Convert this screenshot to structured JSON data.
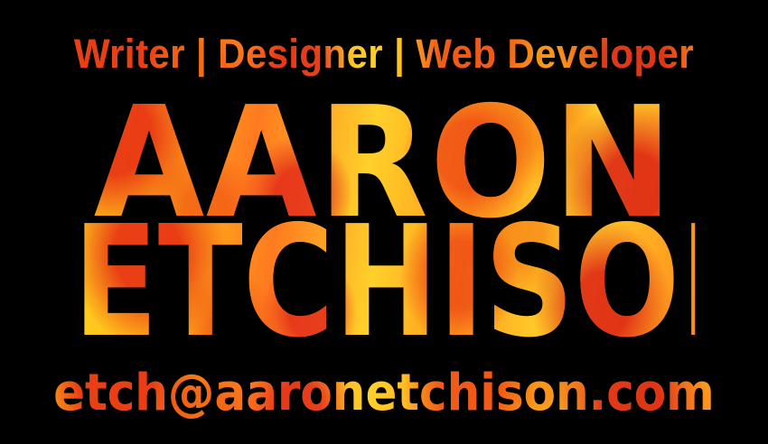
{
  "card": {
    "tagline": "Writer | Designer | Web Developer",
    "first_name": "AARON",
    "last_name": "ETCHISON",
    "email": "etch@aaronetchison.com"
  },
  "colors": {
    "background": "#000000",
    "text_yellow": "#ffd21f",
    "text_orange": "#ff8a1a",
    "text_red": "#e0281a"
  }
}
